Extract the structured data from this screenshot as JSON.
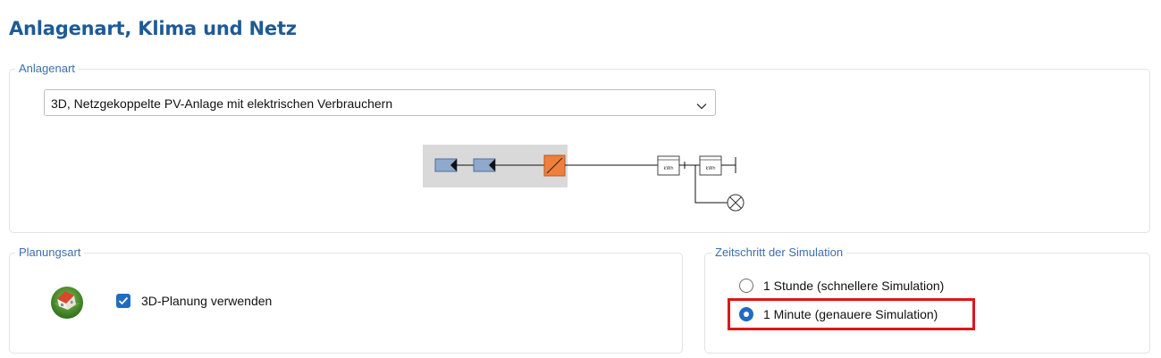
{
  "page": {
    "title": "Anlagenart, Klima und Netz"
  },
  "anlagenart": {
    "legend": "Anlagenart",
    "selected": "3D, Netzgekoppelte PV-Anlage mit elektrischen Verbrauchern",
    "meter_label": "kWh"
  },
  "planungsart": {
    "legend": "Planungsart",
    "checkbox_label": "3D-Planung verwenden",
    "checked": true
  },
  "zeitschritt": {
    "legend": "Zeitschritt der Simulation",
    "options": [
      {
        "label": "1 Stunde (schnellere Simulation)",
        "selected": false
      },
      {
        "label": "1 Minute (genauere Simulation)",
        "selected": true
      }
    ]
  },
  "colors": {
    "title": "#1e5a96",
    "legend": "#3a6fb0",
    "accent": "#1f6cc0",
    "highlight": "#e0151a",
    "inverter": "#f07f3c",
    "module": "#8fa9cc"
  }
}
